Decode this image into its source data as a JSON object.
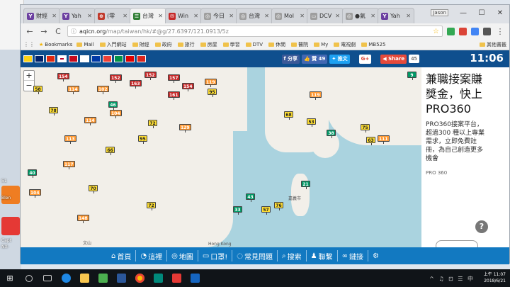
{
  "desktop": {
    "labels": [
      "Blen",
      "Capt",
      "NX-"
    ],
    "number_label": "51"
  },
  "browser": {
    "tabs": [
      {
        "label": "財經",
        "color": "#6b3fa0",
        "glyph": "Y"
      },
      {
        "label": "Yah",
        "color": "#6b3fa0",
        "glyph": "Y"
      },
      {
        "label": "(零",
        "color": "#c0392b",
        "glyph": "⊕"
      },
      {
        "label": "台灣",
        "color": "#2e7d32",
        "glyph": "☰"
      },
      {
        "label": "Win",
        "color": "#c62828",
        "glyph": "✉"
      },
      {
        "label": "今日",
        "color": "#9e9e9e",
        "glyph": "◎"
      },
      {
        "label": "台灣",
        "color": "#9e9e9e",
        "glyph": "◎"
      },
      {
        "label": "Mol",
        "color": "#9e9e9e",
        "glyph": "◎"
      },
      {
        "label": "DCV",
        "color": "#9e9e9e",
        "glyph": "▭"
      },
      {
        "label": "●氣",
        "color": "#9e9e9e",
        "glyph": "◎"
      },
      {
        "label": "Yah",
        "color": "#6b3fa0",
        "glyph": "Y"
      }
    ],
    "user_chip": "Jason",
    "window_controls": {
      "minimize": "—",
      "maximize": "☐",
      "close": "✕"
    },
    "nav": {
      "back": "←",
      "forward": "→",
      "reload": "C"
    },
    "url_host": "aqicn.org",
    "url_path": "/map/taiwan/hk/#@g/27.6397/121.0913/5z",
    "bookmarks_label": "Bookmarks",
    "bookmarks": [
      "Mail",
      "入門網站",
      "財經",
      "政府",
      "旅行",
      "房屋",
      "學習",
      "DTV",
      "休閒",
      "醫院",
      "My",
      "電視劇",
      "MB525"
    ],
    "other_bookmarks": "其他書籤"
  },
  "page": {
    "share": {
      "fb_label": "分享",
      "like_label": "贊 49",
      "twitter_label": "推文",
      "gplus_label": "G+",
      "share_label": "Share",
      "share_count": "45"
    },
    "clock": "11:06",
    "zoom": {
      "in": "+",
      "out": "−"
    },
    "map_labels": {
      "hongkong": "Hong Kong",
      "wenshan": "文山",
      "jiayi": "嘉義市"
    },
    "markers": [
      {
        "v": "154",
        "c": "#c62828"
      },
      {
        "v": "58",
        "c": "#ffde33"
      },
      {
        "v": "114",
        "c": "#ff9933"
      },
      {
        "v": "152",
        "c": "#c62828"
      },
      {
        "v": "102",
        "c": "#ff9933"
      },
      {
        "v": "163",
        "c": "#c62828"
      },
      {
        "v": "152",
        "c": "#c62828"
      },
      {
        "v": "157",
        "c": "#c62828"
      },
      {
        "v": "154",
        "c": "#c62828"
      },
      {
        "v": "161",
        "c": "#c62828"
      },
      {
        "v": "119",
        "c": "#ff9933"
      },
      {
        "v": "95",
        "c": "#ffde33"
      },
      {
        "v": "78",
        "c": "#ffde33"
      },
      {
        "v": "114",
        "c": "#ff9933"
      },
      {
        "v": "104",
        "c": "#ff9933"
      },
      {
        "v": "72",
        "c": "#ffde33"
      },
      {
        "v": "46",
        "c": "#009966"
      },
      {
        "v": "113",
        "c": "#ff9933"
      },
      {
        "v": "129",
        "c": "#ff9933"
      },
      {
        "v": "95",
        "c": "#ffde33"
      },
      {
        "v": "66",
        "c": "#ffde33"
      },
      {
        "v": "117",
        "c": "#ff9933"
      },
      {
        "v": "40",
        "c": "#009966"
      },
      {
        "v": "104",
        "c": "#ff9933"
      },
      {
        "v": "70",
        "c": "#ffde33"
      },
      {
        "v": "148",
        "c": "#ff9933"
      },
      {
        "v": "72",
        "c": "#ffde33"
      },
      {
        "v": "43",
        "c": "#009966"
      },
      {
        "v": "33",
        "c": "#009966"
      },
      {
        "v": "57",
        "c": "#ffde33"
      },
      {
        "v": "76",
        "c": "#ffde33"
      },
      {
        "v": "21",
        "c": "#009966"
      },
      {
        "v": "68",
        "c": "#ffde33"
      },
      {
        "v": "53",
        "c": "#ffde33"
      },
      {
        "v": "38",
        "c": "#009966"
      },
      {
        "v": "9",
        "c": "#009966"
      },
      {
        "v": "119",
        "c": "#ff9933"
      },
      {
        "v": "75",
        "c": "#ffde33"
      },
      {
        "v": "63",
        "c": "#ffde33"
      },
      {
        "v": "111",
        "c": "#ff9933"
      }
    ],
    "ad": {
      "headline": "兼職接案賺獎金，快上PRO360",
      "body": "PRO360接案平台，超過300 種以上專業需求，立即免費註冊，為自己創造更多機會",
      "source": "PRO 360",
      "more": "?"
    },
    "bottom_nav": [
      {
        "icon": "⌂",
        "label": "首頁"
      },
      {
        "icon": "◔",
        "label": "這裡"
      },
      {
        "icon": "◎",
        "label": "地圖"
      },
      {
        "icon": "▭",
        "label": "口罩!"
      },
      {
        "icon": "◌",
        "label": "常見問題"
      },
      {
        "icon": "⌕",
        "label": "搜索"
      },
      {
        "icon": "♟",
        "label": "聯繫"
      },
      {
        "icon": "∞",
        "label": "鏈接"
      },
      {
        "icon": "⚙",
        "label": ""
      }
    ]
  },
  "taskbar": {
    "time": "上午 11:07",
    "date": "2018/6/21",
    "tray": "^ ♫ ⊡ ☰ 中"
  }
}
